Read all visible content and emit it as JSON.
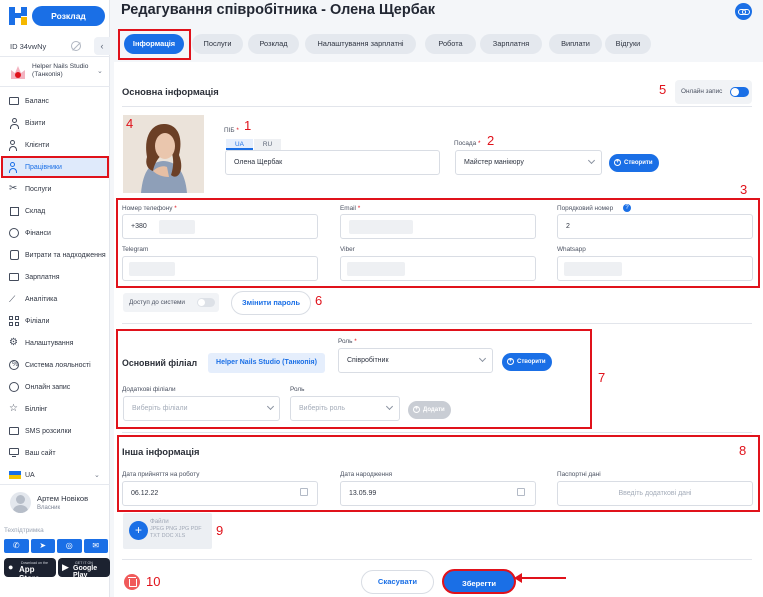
{
  "app": {
    "primary_button": "Розклад",
    "org_id": "ID 34vwNy",
    "branch": "Helper Nails Studio (Танкопія)"
  },
  "sidebar": {
    "items": [
      {
        "label": "Баланс",
        "icon": "wallet-icon"
      },
      {
        "label": "Візити",
        "icon": "user-icon"
      },
      {
        "label": "Клієнти",
        "icon": "users-icon"
      },
      {
        "label": "Працівники",
        "icon": "staff-icon",
        "active": true
      },
      {
        "label": "Послуги",
        "icon": "scissors-icon"
      },
      {
        "label": "Склад",
        "icon": "box-icon"
      },
      {
        "label": "Фінанси",
        "icon": "coins-icon"
      },
      {
        "label": "Витрати та надходження",
        "icon": "cash-icon"
      },
      {
        "label": "Зарплатня",
        "icon": "salary-icon"
      },
      {
        "label": "Аналітика",
        "icon": "chart-icon"
      },
      {
        "label": "Філіали",
        "icon": "grid-icon"
      },
      {
        "label": "Налаштування",
        "icon": "gear-icon"
      },
      {
        "label": "Система лояльності",
        "icon": "percent-icon"
      },
      {
        "label": "Онлайн запис",
        "icon": "globe-icon"
      },
      {
        "label": "Біллінг",
        "icon": "star-icon"
      },
      {
        "label": "SMS розсилки",
        "icon": "sms-icon"
      },
      {
        "label": "Ваш сайт",
        "icon": "monitor-icon"
      }
    ],
    "language": "UA",
    "user": {
      "name": "Артем Новіков",
      "role": "Власник"
    },
    "support_label": "Техпідтримка",
    "app_store": {
      "small": "Download on the",
      "big": "App Store"
    },
    "google_play": {
      "small": "GET IT ON",
      "big": "Google Play"
    }
  },
  "header": {
    "title": "Редагування співробітника - Олена Щербак"
  },
  "tabs": [
    "Інформація",
    "Послуги",
    "Розклад",
    "Налаштування зарплатні",
    "Робота",
    "Зарплатня",
    "Виплати",
    "Відгуки"
  ],
  "basic": {
    "section_title": "Основна інформація",
    "online_booking_label": "Онлайн запис",
    "name_label": "ПІБ",
    "lang_ua": "UA",
    "lang_ru": "RU",
    "name_value": "Олена Щербак",
    "position_label": "Посада",
    "position_value": "Майстер манікюру",
    "create_label": "Створити"
  },
  "contacts": {
    "phone_label": "Номер телефону",
    "phone_value": "+380",
    "email_label": "Email",
    "order_label": "Порядковий номер",
    "order_value": "2",
    "telegram_label": "Telegram",
    "viber_label": "Viber",
    "whatsapp_label": "Whatsapp",
    "access_label": "Доступ до системи",
    "change_password": "Змінити пароль"
  },
  "branches": {
    "main_branch_label": "Основний філіал",
    "main_branch_value": "Helper Nails Studio (Танкопія)",
    "role_label": "Роль",
    "role_value": "Співробітник",
    "extra_branches_label": "Додаткові філіали",
    "extra_branches_placeholder": "Виберіть філіали",
    "role2_label": "Роль",
    "role2_placeholder": "Виберіть роль",
    "add_label": "Додати"
  },
  "other": {
    "section_title": "Інша інформація",
    "hire_label": "Дата прийняття на роботу",
    "hire_value": "06.12.22",
    "birth_label": "Дата народження",
    "birth_value": "13.05.99",
    "passport_label": "Паспортні дані",
    "passport_placeholder": "Введіть додаткові дані"
  },
  "files": {
    "title": "Файли",
    "types": "JPEG PNG JPG PDF TXT DOC XLS"
  },
  "actions": {
    "cancel": "Скасувати",
    "save": "Зберегти"
  },
  "annotations": [
    "1",
    "2",
    "3",
    "4",
    "5",
    "6",
    "7",
    "8",
    "9",
    "10"
  ],
  "colors": {
    "accent": "#1a6fe6",
    "annotation": "#e0121b"
  }
}
